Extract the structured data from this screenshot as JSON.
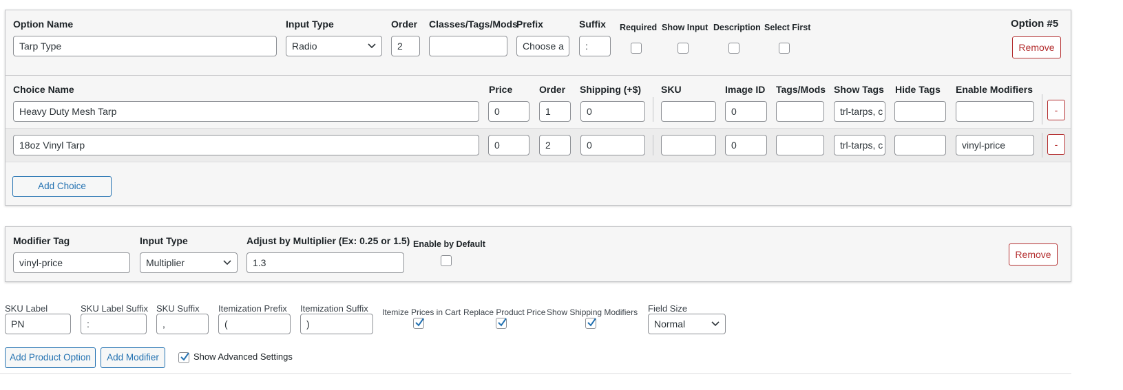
{
  "option": {
    "headers": {
      "name": "Option Name",
      "input_type": "Input Type",
      "order": "Order",
      "classes": "Classes/Tags/Mods",
      "prefix": "Prefix",
      "suffix": "Suffix",
      "required": "Required",
      "show_input": "Show Input",
      "description": "Description",
      "select_first": "Select First"
    },
    "title": "Option #5",
    "values": {
      "name": "Tarp Type",
      "input_type": "Radio",
      "order": "2",
      "classes": "",
      "prefix": "Choose a",
      "suffix": ":"
    },
    "checkboxes": {
      "required": false,
      "show_input": false,
      "description": false,
      "select_first": false
    },
    "remove_label": "Remove"
  },
  "choices": {
    "headers": {
      "name": "Choice Name",
      "price": "Price",
      "order": "Order",
      "shipping": "Shipping (+$)",
      "sku": "SKU",
      "image_id": "Image ID",
      "tags_mods": "Tags/Mods",
      "show_tags": "Show Tags",
      "hide_tags": "Hide Tags",
      "enable_modifiers": "Enable Modifiers"
    },
    "rows": [
      {
        "name": "Heavy Duty Mesh Tarp",
        "price": "0",
        "order": "1",
        "shipping": "0",
        "sku": "",
        "image_id": "0",
        "tags_mods": "",
        "show_tags": "trl-tarps, c",
        "hide_tags": "",
        "enable_modifiers": "",
        "remove": "-"
      },
      {
        "name": "18oz Vinyl Tarp",
        "price": "0",
        "order": "2",
        "shipping": "0",
        "sku": "",
        "image_id": "0",
        "tags_mods": "",
        "show_tags": "trl-tarps, c",
        "hide_tags": "",
        "enable_modifiers": "vinyl-price",
        "remove": "-"
      }
    ],
    "add_choice_label": "Add Choice"
  },
  "modifier": {
    "headers": {
      "tag": "Modifier Tag",
      "input_type": "Input Type",
      "adjust": "Adjust by Multiplier (Ex: 0.25 or 1.5)",
      "enable_default": "Enable by Default"
    },
    "values": {
      "tag": "vinyl-price",
      "input_type": "Multiplier",
      "adjust": "1.3"
    },
    "enable_default": false,
    "remove_label": "Remove"
  },
  "settings": {
    "labels": {
      "sku_label": "SKU Label",
      "sku_label_suffix": "SKU Label Suffix",
      "sku_suffix": "SKU Suffix",
      "itemization_prefix": "Itemization Prefix",
      "itemization_suffix": "Itemization Suffix",
      "itemize_prices": "Itemize Prices in Cart",
      "replace_price": "Replace Product Price",
      "show_shipping": "Show Shipping Modifiers",
      "field_size": "Field Size"
    },
    "values": {
      "sku_label": "PN",
      "sku_label_suffix": ":",
      "sku_suffix": ",",
      "itemization_prefix": "(",
      "itemization_suffix": ")",
      "field_size": "Normal"
    },
    "checkboxes": {
      "itemize_prices": true,
      "replace_price": true,
      "show_shipping": true
    }
  },
  "footer": {
    "add_product_option": "Add Product Option",
    "add_modifier": "Add Modifier",
    "show_advanced": "Show Advanced Settings",
    "show_advanced_checked": true
  },
  "colors": {
    "accent_blue": "#2271b1",
    "danger_red": "#b32d2e",
    "panel_bg": "#f6f6f6",
    "border": "#8c8f94"
  }
}
